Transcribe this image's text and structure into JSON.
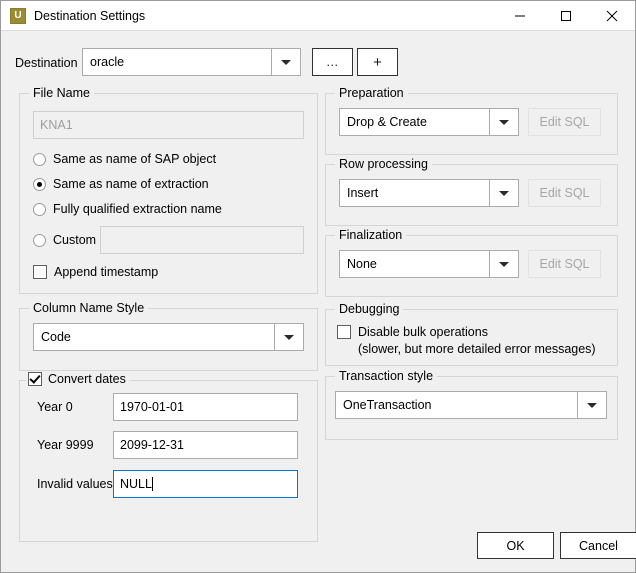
{
  "window": {
    "title": "Destination Settings",
    "app_icon_letter": "U",
    "app_icon_color": "#9b8c33",
    "controls": {
      "minimize": "minimize-icon",
      "maximize": "maximize-icon",
      "close": "close-icon"
    }
  },
  "destination": {
    "label": "Destination",
    "value": "oracle",
    "browse_button": "...",
    "add_button": "+"
  },
  "file_name": {
    "group_title": "File Name",
    "preview_value": "KNA1",
    "options": [
      {
        "label": "Same as name of SAP object",
        "selected": false
      },
      {
        "label": "Same as name of extraction",
        "selected": true
      },
      {
        "label": "Fully qualified extraction name",
        "selected": false
      },
      {
        "label": "Custom",
        "selected": false
      }
    ],
    "custom_value": "",
    "append_timestamp": {
      "label": "Append timestamp",
      "checked": false
    }
  },
  "column_name_style": {
    "group_title": "Column Name Style",
    "value": "Code"
  },
  "convert_dates": {
    "group_title": "Convert dates",
    "checked": true,
    "fields": [
      {
        "label": "Year 0",
        "value": "1970-01-01",
        "focused": false
      },
      {
        "label": "Year 9999",
        "value": "2099-12-31",
        "focused": false
      },
      {
        "label": "Invalid values",
        "value": "NULL",
        "focused": true
      }
    ]
  },
  "preparation": {
    "group_title": "Preparation",
    "value": "Drop & Create",
    "edit_sql_label": "Edit SQL",
    "edit_sql_enabled": false
  },
  "row_processing": {
    "group_title": "Row processing",
    "value": "Insert",
    "edit_sql_label": "Edit SQL",
    "edit_sql_enabled": false
  },
  "finalization": {
    "group_title": "Finalization",
    "value": "None",
    "edit_sql_label": "Edit SQL",
    "edit_sql_enabled": false
  },
  "debugging": {
    "group_title": "Debugging",
    "disable_bulk_label": "Disable bulk operations",
    "disable_bulk_note": "(slower, but more detailed error messages)",
    "disable_bulk_checked": false
  },
  "transaction_style": {
    "group_title": "Transaction style",
    "value": "OneTransaction"
  },
  "footer": {
    "ok_label": "OK",
    "cancel_label": "Cancel"
  },
  "colors": {
    "window_bg": "#f0f0f0",
    "titlebar_bg": "#ffffff",
    "accent_focus": "#0078d7",
    "group_border": "#d5d5d5"
  }
}
